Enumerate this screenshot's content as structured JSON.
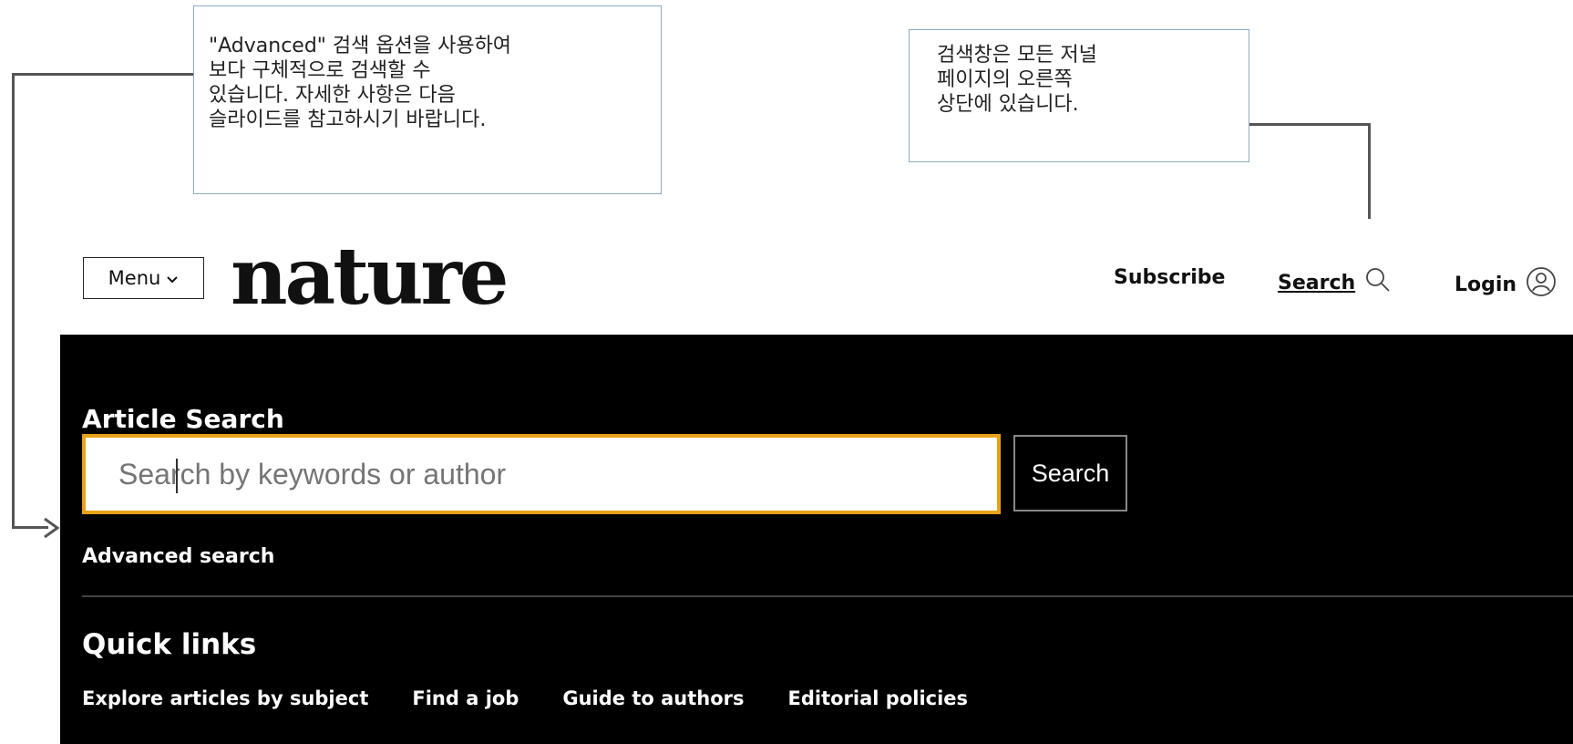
{
  "callouts": {
    "left_text": "\"Advanced\" 검색 옵션을 사용하여\n보다 구체적으로 검색할 수\n있습니다. 자세한 사항은 다음\n슬라이드를 참고하시기 바랍니다.",
    "right_text": "검색창은 모든 저널\n페이지의 오른쪽\n상단에 있습니다."
  },
  "header": {
    "menu_label": "Menu",
    "logo": "nature",
    "subscribe_label": "Subscribe",
    "search_label": "Search",
    "login_label": "Login"
  },
  "search_panel": {
    "title": "Article Search",
    "input_placeholder": "Search by keywords or author",
    "button_label": "Search",
    "advanced_label": "Advanced search"
  },
  "quick_links": {
    "title": "Quick links",
    "items": [
      "Explore articles by subject",
      "Find a job",
      "Guide to authors",
      "Editorial policies"
    ]
  },
  "colors": {
    "panel_bg": "#000000",
    "input_border": "#e8a21a",
    "callout_border": "#8eaac6"
  }
}
